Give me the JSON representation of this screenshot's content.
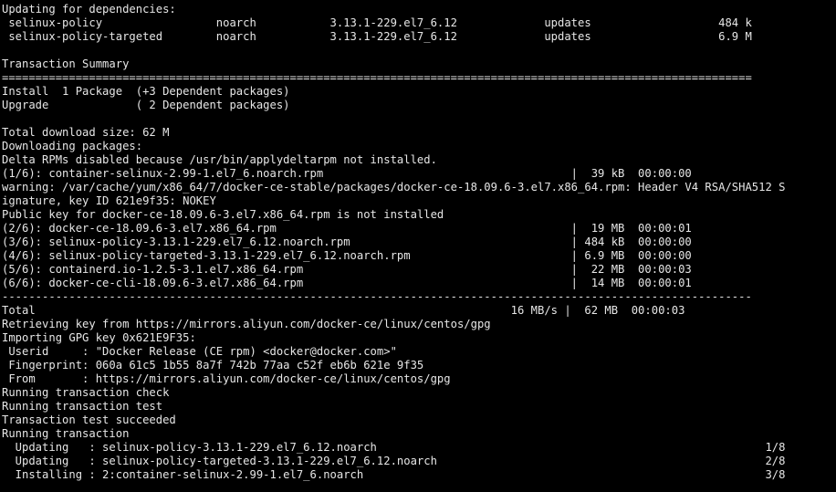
{
  "terminal": {
    "background": "#000000",
    "foreground": "#e6e6e6",
    "lines": [
      "Updating for dependencies:",
      " selinux-policy                 noarch           3.13.1-229.el7_6.12             updates                   484 k",
      " selinux-policy-targeted        noarch           3.13.1-229.el7_6.12             updates                   6.9 M",
      "",
      "Transaction Summary",
      "================================================================================================================",
      "Install  1 Package  (+3 Dependent packages)",
      "Upgrade             ( 2 Dependent packages)",
      "",
      "Total download size: 62 M",
      "Downloading packages:",
      "Delta RPMs disabled because /usr/bin/applydeltarpm not installed.",
      "(1/6): container-selinux-2.99-1.el7_6.noarch.rpm                                     |  39 kB  00:00:00",
      "warning: /var/cache/yum/x86_64/7/docker-ce-stable/packages/docker-ce-18.09.6-3.el7.x86_64.rpm: Header V4 RSA/SHA512 S",
      "ignature, key ID 621e9f35: NOKEY",
      "Public key for docker-ce-18.09.6-3.el7.x86_64.rpm is not installed",
      "(2/6): docker-ce-18.09.6-3.el7.x86_64.rpm                                            |  19 MB  00:00:01",
      "(3/6): selinux-policy-3.13.1-229.el7_6.12.noarch.rpm                                 | 484 kB  00:00:00",
      "(4/6): selinux-policy-targeted-3.13.1-229.el7_6.12.noarch.rpm                        | 6.9 MB  00:00:00",
      "(5/6): containerd.io-1.2.5-3.1.el7.x86_64.rpm                                        |  22 MB  00:00:03",
      "(6/6): docker-ce-cli-18.09.6-3.el7.x86_64.rpm                                        |  14 MB  00:00:01",
      "----------------------------------------------------------------------------------------------------------------",
      "Total                                                                       16 MB/s |  62 MB  00:00:03",
      "Retrieving key from https://mirrors.aliyun.com/docker-ce/linux/centos/gpg",
      "Importing GPG key 0x621E9F35:",
      " Userid     : \"Docker Release (CE rpm) <docker@docker.com>\"",
      " Fingerprint: 060a 61c5 1b55 8a7f 742b 77aa c52f eb6b 621e 9f35",
      " From       : https://mirrors.aliyun.com/docker-ce/linux/centos/gpg",
      "Running transaction check",
      "Running transaction test",
      "Transaction test succeeded",
      "Running transaction",
      "  Updating   : selinux-policy-3.13.1-229.el7_6.12.noarch                                                          1/8",
      "  Updating   : selinux-policy-targeted-3.13.1-229.el7_6.12.noarch                                                 2/8",
      "  Installing : 2:container-selinux-2.99-1.el7_6.noarch                                                            3/8"
    ]
  }
}
